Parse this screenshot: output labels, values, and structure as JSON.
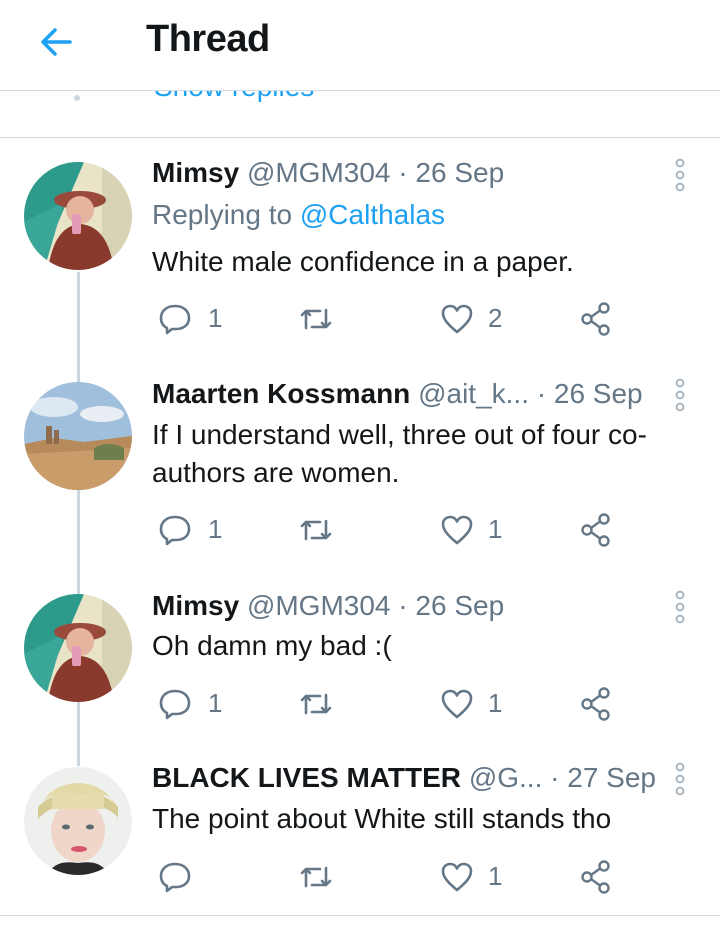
{
  "header": {
    "title": "Thread"
  },
  "show_replies": {
    "label": "Show replies"
  },
  "tweets": [
    {
      "name": "Mimsy",
      "handle": "@MGM304",
      "dot": " · ",
      "date": "26 Sep",
      "reply_prefix": "Replying to ",
      "reply_target": "@Calthalas",
      "text": "White male confidence in a paper.",
      "reply_count": "1",
      "retweet_count": "",
      "like_count": "2"
    },
    {
      "name": "Maarten Kossmann",
      "handle": "@ait_k...",
      "dot": " · ",
      "date": "26 Sep",
      "text": "If I understand well, three out of four co-authors are women.",
      "reply_count": "1",
      "retweet_count": "",
      "like_count": "1"
    },
    {
      "name": "Mimsy",
      "handle": "@MGM304",
      "dot": " · ",
      "date": "26 Sep",
      "text": "Oh damn my bad :(",
      "reply_count": "1",
      "retweet_count": "",
      "like_count": "1"
    },
    {
      "name": "BLACK LIVES MATTER",
      "handle": "@G...",
      "dot": " · ",
      "date": "27 Sep",
      "text": "The point about White still stands tho",
      "reply_count": "",
      "retweet_count": "",
      "like_count": "1"
    }
  ],
  "colors": {
    "accent": "#1da1f2",
    "muted": "#657786",
    "line": "#ccd6dd"
  }
}
